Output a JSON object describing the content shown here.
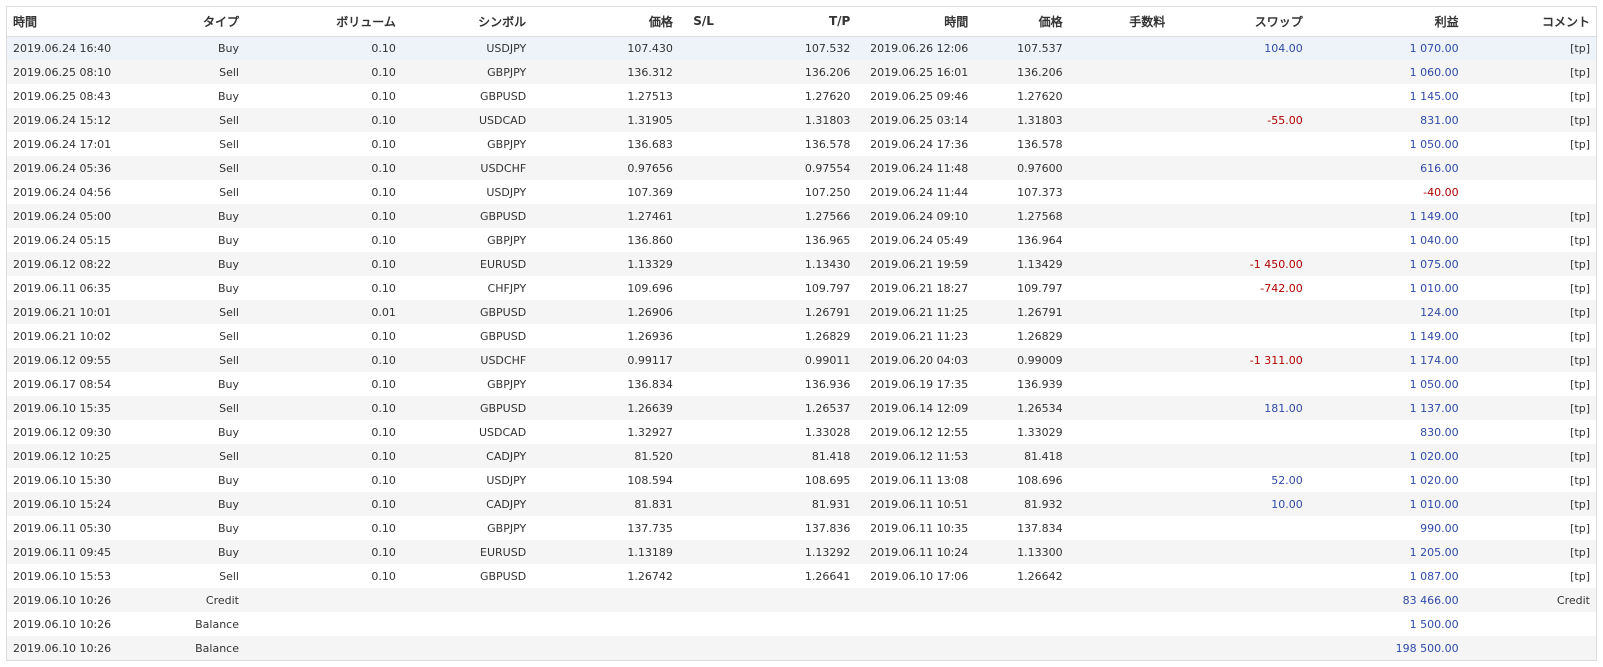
{
  "headers": [
    "時間",
    "タイプ",
    "ボリューム",
    "シンボル",
    "価格",
    "S/L",
    "T/P",
    "時間",
    "価格",
    "手数料",
    "スワップ",
    "利益",
    "コメント"
  ],
  "rows": [
    [
      "2019.06.24 16:40",
      "Buy",
      "0.10",
      "USDJPY",
      "107.430",
      "",
      "107.532",
      "2019.06.26 12:06",
      "107.537",
      "",
      "104.00",
      "1 070.00",
      "[tp]"
    ],
    [
      "2019.06.25 08:10",
      "Sell",
      "0.10",
      "GBPJPY",
      "136.312",
      "",
      "136.206",
      "2019.06.25 16:01",
      "136.206",
      "",
      "",
      "1 060.00",
      "[tp]"
    ],
    [
      "2019.06.25 08:43",
      "Buy",
      "0.10",
      "GBPUSD",
      "1.27513",
      "",
      "1.27620",
      "2019.06.25 09:46",
      "1.27620",
      "",
      "",
      "1 145.00",
      "[tp]"
    ],
    [
      "2019.06.24 15:12",
      "Sell",
      "0.10",
      "USDCAD",
      "1.31905",
      "",
      "1.31803",
      "2019.06.25 03:14",
      "1.31803",
      "",
      "-55.00",
      "831.00",
      "[tp]"
    ],
    [
      "2019.06.24 17:01",
      "Sell",
      "0.10",
      "GBPJPY",
      "136.683",
      "",
      "136.578",
      "2019.06.24 17:36",
      "136.578",
      "",
      "",
      "1 050.00",
      "[tp]"
    ],
    [
      "2019.06.24 05:36",
      "Sell",
      "0.10",
      "USDCHF",
      "0.97656",
      "",
      "0.97554",
      "2019.06.24 11:48",
      "0.97600",
      "",
      "",
      "616.00",
      ""
    ],
    [
      "2019.06.24 04:56",
      "Sell",
      "0.10",
      "USDJPY",
      "107.369",
      "",
      "107.250",
      "2019.06.24 11:44",
      "107.373",
      "",
      "",
      "-40.00",
      ""
    ],
    [
      "2019.06.24 05:00",
      "Buy",
      "0.10",
      "GBPUSD",
      "1.27461",
      "",
      "1.27566",
      "2019.06.24 09:10",
      "1.27568",
      "",
      "",
      "1 149.00",
      "[tp]"
    ],
    [
      "2019.06.24 05:15",
      "Buy",
      "0.10",
      "GBPJPY",
      "136.860",
      "",
      "136.965",
      "2019.06.24 05:49",
      "136.964",
      "",
      "",
      "1 040.00",
      "[tp]"
    ],
    [
      "2019.06.12 08:22",
      "Buy",
      "0.10",
      "EURUSD",
      "1.13329",
      "",
      "1.13430",
      "2019.06.21 19:59",
      "1.13429",
      "",
      "-1 450.00",
      "1 075.00",
      "[tp]"
    ],
    [
      "2019.06.11 06:35",
      "Buy",
      "0.10",
      "CHFJPY",
      "109.696",
      "",
      "109.797",
      "2019.06.21 18:27",
      "109.797",
      "",
      "-742.00",
      "1 010.00",
      "[tp]"
    ],
    [
      "2019.06.21 10:01",
      "Sell",
      "0.01",
      "GBPUSD",
      "1.26906",
      "",
      "1.26791",
      "2019.06.21 11:25",
      "1.26791",
      "",
      "",
      "124.00",
      "[tp]"
    ],
    [
      "2019.06.21 10:02",
      "Sell",
      "0.10",
      "GBPUSD",
      "1.26936",
      "",
      "1.26829",
      "2019.06.21 11:23",
      "1.26829",
      "",
      "",
      "1 149.00",
      "[tp]"
    ],
    [
      "2019.06.12 09:55",
      "Sell",
      "0.10",
      "USDCHF",
      "0.99117",
      "",
      "0.99011",
      "2019.06.20 04:03",
      "0.99009",
      "",
      "-1 311.00",
      "1 174.00",
      "[tp]"
    ],
    [
      "2019.06.17 08:54",
      "Buy",
      "0.10",
      "GBPJPY",
      "136.834",
      "",
      "136.936",
      "2019.06.19 17:35",
      "136.939",
      "",
      "",
      "1 050.00",
      "[tp]"
    ],
    [
      "2019.06.10 15:35",
      "Sell",
      "0.10",
      "GBPUSD",
      "1.26639",
      "",
      "1.26537",
      "2019.06.14 12:09",
      "1.26534",
      "",
      "181.00",
      "1 137.00",
      "[tp]"
    ],
    [
      "2019.06.12 09:30",
      "Buy",
      "0.10",
      "USDCAD",
      "1.32927",
      "",
      "1.33028",
      "2019.06.12 12:55",
      "1.33029",
      "",
      "",
      "830.00",
      "[tp]"
    ],
    [
      "2019.06.12 10:25",
      "Sell",
      "0.10",
      "CADJPY",
      "81.520",
      "",
      "81.418",
      "2019.06.12 11:53",
      "81.418",
      "",
      "",
      "1 020.00",
      "[tp]"
    ],
    [
      "2019.06.10 15:30",
      "Buy",
      "0.10",
      "USDJPY",
      "108.594",
      "",
      "108.695",
      "2019.06.11 13:08",
      "108.696",
      "",
      "52.00",
      "1 020.00",
      "[tp]"
    ],
    [
      "2019.06.10 15:24",
      "Buy",
      "0.10",
      "CADJPY",
      "81.831",
      "",
      "81.931",
      "2019.06.11 10:51",
      "81.932",
      "",
      "10.00",
      "1 010.00",
      "[tp]"
    ],
    [
      "2019.06.11 05:30",
      "Buy",
      "0.10",
      "GBPJPY",
      "137.735",
      "",
      "137.836",
      "2019.06.11 10:35",
      "137.834",
      "",
      "",
      "990.00",
      "[tp]"
    ],
    [
      "2019.06.11 09:45",
      "Buy",
      "0.10",
      "EURUSD",
      "1.13189",
      "",
      "1.13292",
      "2019.06.11 10:24",
      "1.13300",
      "",
      "",
      "1 205.00",
      "[tp]"
    ],
    [
      "2019.06.10 15:53",
      "Sell",
      "0.10",
      "GBPUSD",
      "1.26742",
      "",
      "1.26641",
      "2019.06.10 17:06",
      "1.26642",
      "",
      "",
      "1 087.00",
      "[tp]"
    ],
    [
      "2019.06.10 10:26",
      "Credit",
      "",
      "",
      "",
      "",
      "",
      "",
      "",
      "",
      "",
      "83 466.00",
      "Credit"
    ],
    [
      "2019.06.10 10:26",
      "Balance",
      "",
      "",
      "",
      "",
      "",
      "",
      "",
      "",
      "",
      "1 500.00",
      ""
    ],
    [
      "2019.06.10 10:26",
      "Balance",
      "",
      "",
      "",
      "",
      "",
      "",
      "",
      "",
      "",
      "198 500.00",
      ""
    ]
  ],
  "colors": {
    "positive": "#2f4ba8",
    "negative": "#b00000",
    "selected_row": "#eef2f9",
    "alt_row": "#f5f5f5"
  }
}
